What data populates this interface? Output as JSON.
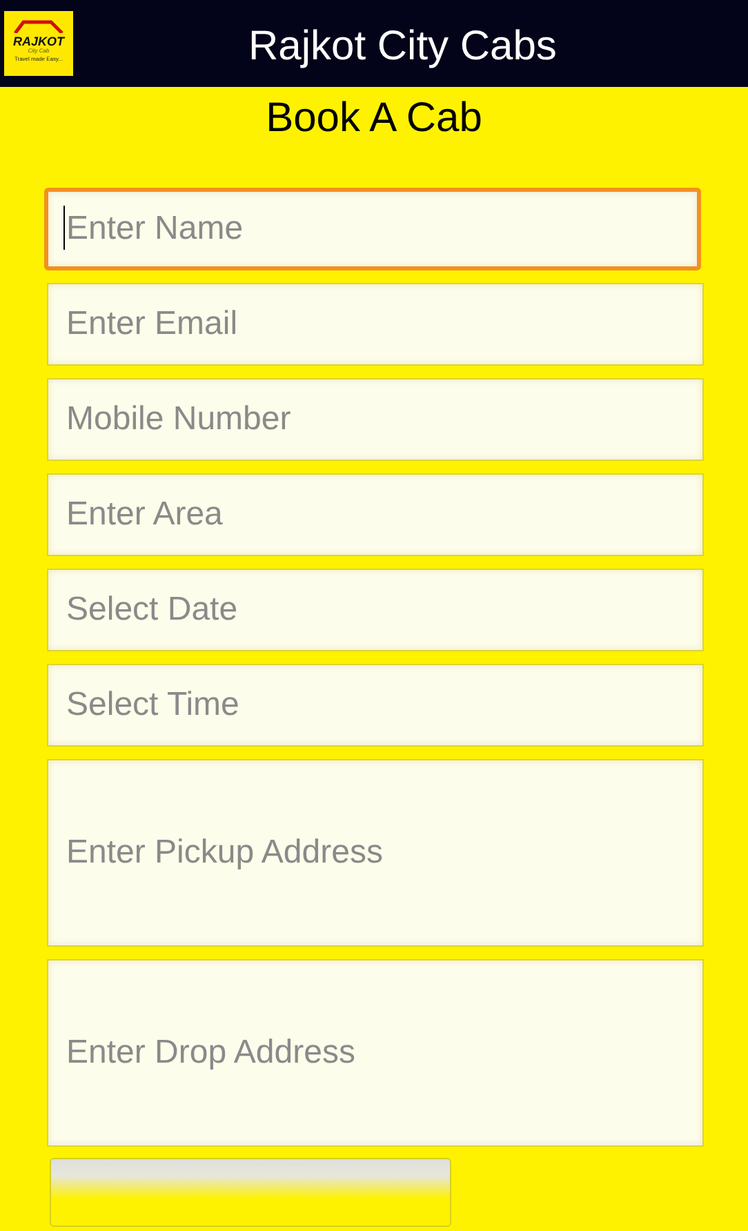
{
  "app_bar": {
    "title": "Rajkot City Cabs",
    "logo": {
      "name": "RAJKOT",
      "sub": "City Cab",
      "tagline": "Travel made Easy..."
    }
  },
  "heading": "Book A Cab",
  "fields": [
    {
      "placeholder": "Enter Name",
      "kind": "single",
      "focused": true
    },
    {
      "placeholder": "Enter Email",
      "kind": "single",
      "focused": false
    },
    {
      "placeholder": "Mobile Number",
      "kind": "single",
      "focused": false
    },
    {
      "placeholder": "Enter Area",
      "kind": "single",
      "focused": false
    },
    {
      "placeholder": "Select Date",
      "kind": "single",
      "focused": false
    },
    {
      "placeholder": "Select Time",
      "kind": "single",
      "focused": false
    },
    {
      "placeholder": "Enter Pickup Address",
      "kind": "multi",
      "focused": false
    },
    {
      "placeholder": "Enter Drop Address",
      "kind": "multi",
      "focused": false
    }
  ]
}
